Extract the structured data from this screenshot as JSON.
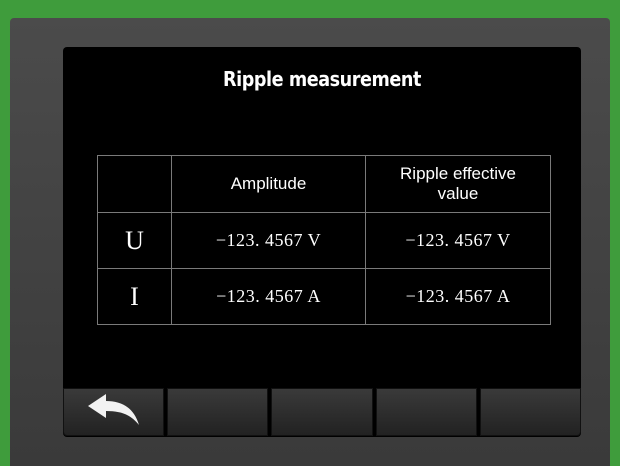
{
  "screen": {
    "title": "Ripple measurement"
  },
  "table": {
    "headers": [
      "",
      "Amplitude",
      "Ripple effective value"
    ],
    "rows": [
      {
        "label": "U",
        "amplitude": "−123. 4567 V",
        "ripple_effective": "−123. 4567 V"
      },
      {
        "label": "I",
        "amplitude": "−123. 4567 A",
        "ripple_effective": "−123. 4567 A"
      }
    ]
  },
  "toolbar": {
    "keys": [
      {
        "icon": "back-arrow-icon"
      },
      {
        "icon": ""
      },
      {
        "icon": ""
      },
      {
        "icon": ""
      },
      {
        "icon": ""
      }
    ]
  }
}
